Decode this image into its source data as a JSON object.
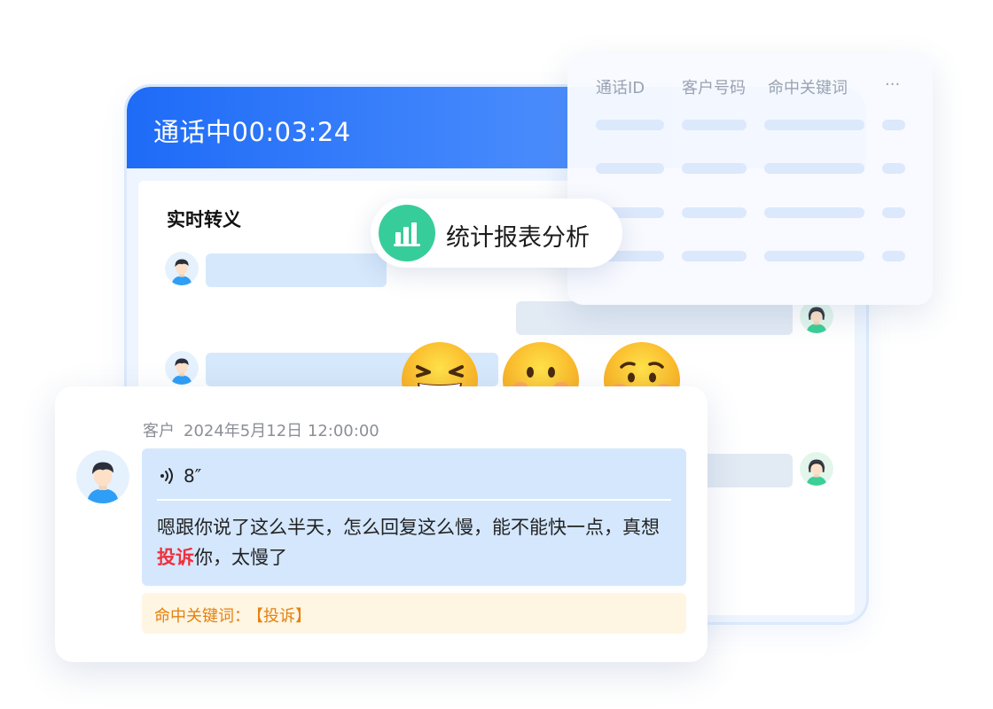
{
  "call": {
    "title": "通话中00:03:24",
    "section_title": "实时转义"
  },
  "table": {
    "headers": [
      "通话ID",
      "客户号码",
      "命中关键词",
      "···"
    ]
  },
  "stats": {
    "label": "统计报表分析",
    "icon": "bar-chart-icon"
  },
  "emojis": [
    "laughing-face",
    "smiling-face",
    "worried-face"
  ],
  "message": {
    "sender": "客户",
    "timestamp": "2024年5月12日 12:00:00",
    "voice_duration": "8″",
    "text_before": "嗯跟你说了这么半天，怎么回复这么慢，能不能快一点，真想",
    "text_keyword": "投诉",
    "text_after": "你，太慢了",
    "keyword_label": "命中关键词：",
    "keyword_value": "【投诉】"
  },
  "colors": {
    "header_blue": "#1e6bf7",
    "stats_green": "#37cd9a",
    "keyword_red": "#f0303c",
    "keyword_orange": "#e3820e"
  }
}
